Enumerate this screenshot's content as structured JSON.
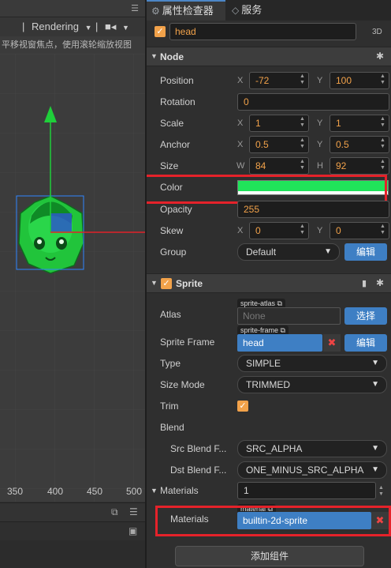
{
  "scene": {
    "toolbar": {
      "sep1": "|",
      "rendering": "Rendering",
      "sep2": "|"
    },
    "hint": "平移视窗焦点，使用滚轮缩放视图",
    "ruler": [
      "350",
      "400",
      "450",
      "500"
    ]
  },
  "tabs": {
    "inspector": "属性检查器",
    "services": "服务"
  },
  "node_header": {
    "name": "head",
    "mode_3d": "3D"
  },
  "node": {
    "title": "Node",
    "position": {
      "label": "Position",
      "x_axis": "X",
      "x": "-72",
      "y_axis": "Y",
      "y": "100"
    },
    "rotation": {
      "label": "Rotation",
      "value": "0"
    },
    "scale": {
      "label": "Scale",
      "x_axis": "X",
      "x": "1",
      "y_axis": "Y",
      "y": "1"
    },
    "anchor": {
      "label": "Anchor",
      "x_axis": "X",
      "x": "0.5",
      "y_axis": "Y",
      "y": "0.5"
    },
    "size": {
      "label": "Size",
      "w_axis": "W",
      "w": "84",
      "h_axis": "H",
      "h": "92"
    },
    "color": {
      "label": "Color",
      "value": "#20e35a"
    },
    "opacity": {
      "label": "Opacity",
      "value": "255"
    },
    "skew": {
      "label": "Skew",
      "x_axis": "X",
      "x": "0",
      "y_axis": "Y",
      "y": "0"
    },
    "group": {
      "label": "Group",
      "value": "Default",
      "edit": "编辑"
    }
  },
  "sprite": {
    "title": "Sprite",
    "atlas": {
      "label": "Atlas",
      "tag": "sprite-atlas",
      "value": "None",
      "select": "选择"
    },
    "sprite_frame": {
      "label": "Sprite Frame",
      "tag": "sprite-frame",
      "value": "head",
      "edit": "编辑"
    },
    "type": {
      "label": "Type",
      "value": "SIMPLE"
    },
    "size_mode": {
      "label": "Size Mode",
      "value": "TRIMMED"
    },
    "trim": {
      "label": "Trim"
    },
    "blend": {
      "label": "Blend"
    },
    "src_blend": {
      "label": "Src Blend F...",
      "value": "SRC_ALPHA"
    },
    "dst_blend": {
      "label": "Dst Blend F...",
      "value": "ONE_MINUS_SRC_ALPHA"
    },
    "materials_count": {
      "label": "Materials",
      "value": "1"
    },
    "material_item": {
      "label": "Materials",
      "tag": "material",
      "value": "builtin-2d-sprite"
    }
  },
  "add_component": "添加组件",
  "colors": {
    "accent": "#3e7fc4",
    "number": "#f2a24a",
    "highlight": "#e5222a",
    "gizmo_green": "#1fcf3a",
    "gizmo_red": "#e0212a"
  }
}
